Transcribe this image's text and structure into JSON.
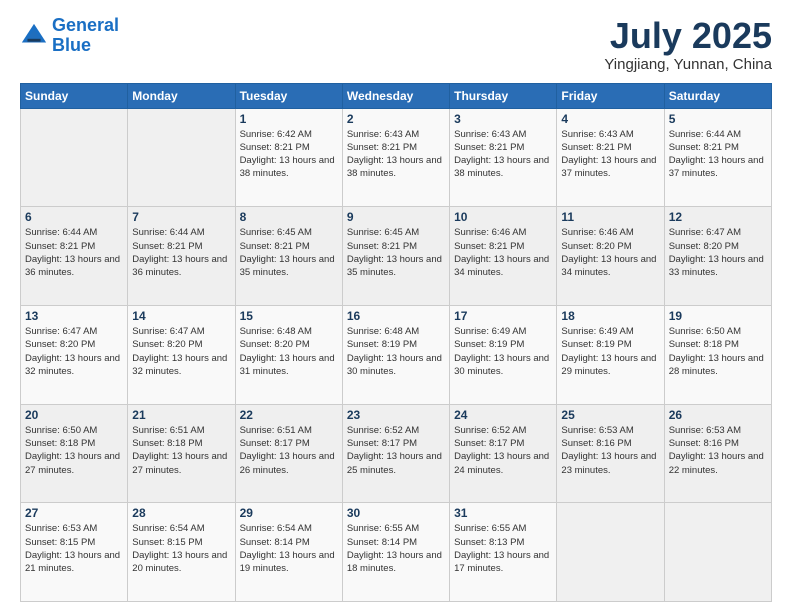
{
  "logo": {
    "line1": "General",
    "line2": "Blue"
  },
  "title": "July 2025",
  "subtitle": "Yingjiang, Yunnan, China",
  "weekdays": [
    "Sunday",
    "Monday",
    "Tuesday",
    "Wednesday",
    "Thursday",
    "Friday",
    "Saturday"
  ],
  "weeks": [
    [
      {
        "day": "",
        "sunrise": "",
        "sunset": "",
        "daylight": ""
      },
      {
        "day": "",
        "sunrise": "",
        "sunset": "",
        "daylight": ""
      },
      {
        "day": "1",
        "sunrise": "Sunrise: 6:42 AM",
        "sunset": "Sunset: 8:21 PM",
        "daylight": "Daylight: 13 hours and 38 minutes."
      },
      {
        "day": "2",
        "sunrise": "Sunrise: 6:43 AM",
        "sunset": "Sunset: 8:21 PM",
        "daylight": "Daylight: 13 hours and 38 minutes."
      },
      {
        "day": "3",
        "sunrise": "Sunrise: 6:43 AM",
        "sunset": "Sunset: 8:21 PM",
        "daylight": "Daylight: 13 hours and 38 minutes."
      },
      {
        "day": "4",
        "sunrise": "Sunrise: 6:43 AM",
        "sunset": "Sunset: 8:21 PM",
        "daylight": "Daylight: 13 hours and 37 minutes."
      },
      {
        "day": "5",
        "sunrise": "Sunrise: 6:44 AM",
        "sunset": "Sunset: 8:21 PM",
        "daylight": "Daylight: 13 hours and 37 minutes."
      }
    ],
    [
      {
        "day": "6",
        "sunrise": "Sunrise: 6:44 AM",
        "sunset": "Sunset: 8:21 PM",
        "daylight": "Daylight: 13 hours and 36 minutes."
      },
      {
        "day": "7",
        "sunrise": "Sunrise: 6:44 AM",
        "sunset": "Sunset: 8:21 PM",
        "daylight": "Daylight: 13 hours and 36 minutes."
      },
      {
        "day": "8",
        "sunrise": "Sunrise: 6:45 AM",
        "sunset": "Sunset: 8:21 PM",
        "daylight": "Daylight: 13 hours and 35 minutes."
      },
      {
        "day": "9",
        "sunrise": "Sunrise: 6:45 AM",
        "sunset": "Sunset: 8:21 PM",
        "daylight": "Daylight: 13 hours and 35 minutes."
      },
      {
        "day": "10",
        "sunrise": "Sunrise: 6:46 AM",
        "sunset": "Sunset: 8:21 PM",
        "daylight": "Daylight: 13 hours and 34 minutes."
      },
      {
        "day": "11",
        "sunrise": "Sunrise: 6:46 AM",
        "sunset": "Sunset: 8:20 PM",
        "daylight": "Daylight: 13 hours and 34 minutes."
      },
      {
        "day": "12",
        "sunrise": "Sunrise: 6:47 AM",
        "sunset": "Sunset: 8:20 PM",
        "daylight": "Daylight: 13 hours and 33 minutes."
      }
    ],
    [
      {
        "day": "13",
        "sunrise": "Sunrise: 6:47 AM",
        "sunset": "Sunset: 8:20 PM",
        "daylight": "Daylight: 13 hours and 32 minutes."
      },
      {
        "day": "14",
        "sunrise": "Sunrise: 6:47 AM",
        "sunset": "Sunset: 8:20 PM",
        "daylight": "Daylight: 13 hours and 32 minutes."
      },
      {
        "day": "15",
        "sunrise": "Sunrise: 6:48 AM",
        "sunset": "Sunset: 8:20 PM",
        "daylight": "Daylight: 13 hours and 31 minutes."
      },
      {
        "day": "16",
        "sunrise": "Sunrise: 6:48 AM",
        "sunset": "Sunset: 8:19 PM",
        "daylight": "Daylight: 13 hours and 30 minutes."
      },
      {
        "day": "17",
        "sunrise": "Sunrise: 6:49 AM",
        "sunset": "Sunset: 8:19 PM",
        "daylight": "Daylight: 13 hours and 30 minutes."
      },
      {
        "day": "18",
        "sunrise": "Sunrise: 6:49 AM",
        "sunset": "Sunset: 8:19 PM",
        "daylight": "Daylight: 13 hours and 29 minutes."
      },
      {
        "day": "19",
        "sunrise": "Sunrise: 6:50 AM",
        "sunset": "Sunset: 8:18 PM",
        "daylight": "Daylight: 13 hours and 28 minutes."
      }
    ],
    [
      {
        "day": "20",
        "sunrise": "Sunrise: 6:50 AM",
        "sunset": "Sunset: 8:18 PM",
        "daylight": "Daylight: 13 hours and 27 minutes."
      },
      {
        "day": "21",
        "sunrise": "Sunrise: 6:51 AM",
        "sunset": "Sunset: 8:18 PM",
        "daylight": "Daylight: 13 hours and 27 minutes."
      },
      {
        "day": "22",
        "sunrise": "Sunrise: 6:51 AM",
        "sunset": "Sunset: 8:17 PM",
        "daylight": "Daylight: 13 hours and 26 minutes."
      },
      {
        "day": "23",
        "sunrise": "Sunrise: 6:52 AM",
        "sunset": "Sunset: 8:17 PM",
        "daylight": "Daylight: 13 hours and 25 minutes."
      },
      {
        "day": "24",
        "sunrise": "Sunrise: 6:52 AM",
        "sunset": "Sunset: 8:17 PM",
        "daylight": "Daylight: 13 hours and 24 minutes."
      },
      {
        "day": "25",
        "sunrise": "Sunrise: 6:53 AM",
        "sunset": "Sunset: 8:16 PM",
        "daylight": "Daylight: 13 hours and 23 minutes."
      },
      {
        "day": "26",
        "sunrise": "Sunrise: 6:53 AM",
        "sunset": "Sunset: 8:16 PM",
        "daylight": "Daylight: 13 hours and 22 minutes."
      }
    ],
    [
      {
        "day": "27",
        "sunrise": "Sunrise: 6:53 AM",
        "sunset": "Sunset: 8:15 PM",
        "daylight": "Daylight: 13 hours and 21 minutes."
      },
      {
        "day": "28",
        "sunrise": "Sunrise: 6:54 AM",
        "sunset": "Sunset: 8:15 PM",
        "daylight": "Daylight: 13 hours and 20 minutes."
      },
      {
        "day": "29",
        "sunrise": "Sunrise: 6:54 AM",
        "sunset": "Sunset: 8:14 PM",
        "daylight": "Daylight: 13 hours and 19 minutes."
      },
      {
        "day": "30",
        "sunrise": "Sunrise: 6:55 AM",
        "sunset": "Sunset: 8:14 PM",
        "daylight": "Daylight: 13 hours and 18 minutes."
      },
      {
        "day": "31",
        "sunrise": "Sunrise: 6:55 AM",
        "sunset": "Sunset: 8:13 PM",
        "daylight": "Daylight: 13 hours and 17 minutes."
      },
      {
        "day": "",
        "sunrise": "",
        "sunset": "",
        "daylight": ""
      },
      {
        "day": "",
        "sunrise": "",
        "sunset": "",
        "daylight": ""
      }
    ]
  ]
}
